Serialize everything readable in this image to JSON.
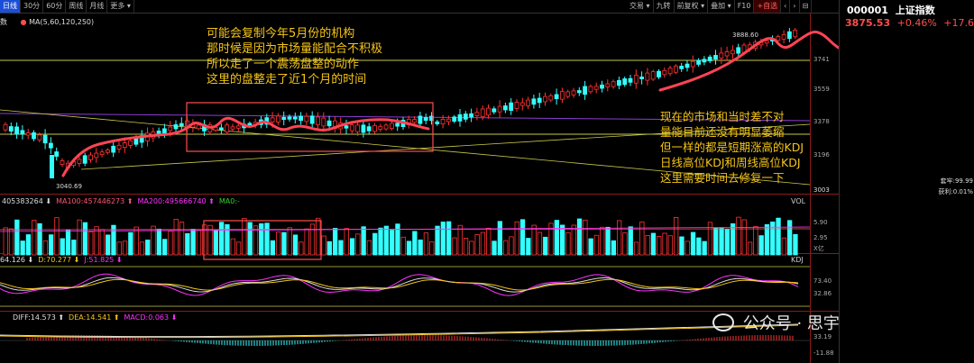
{
  "toolbar_left": [
    "日线",
    "30分",
    "60分",
    "周线",
    "月线",
    "更多 ▾"
  ],
  "toolbar_right": [
    "交易 ▾",
    "九转",
    "前复权 ▾",
    "叠加 ▾",
    "F10",
    "+自选",
    "‹",
    "›",
    "⊟"
  ],
  "ma_label": "MA(5,60,120,250)",
  "vol_title": "VOL",
  "vol_labels": [
    {
      "text": "405383264 ⬇",
      "color": "#dddddd"
    },
    {
      "text": "MA100:457446273 ⬆",
      "color": "#ff5577"
    },
    {
      "text": "MA200:495666740 ⬆",
      "color": "#ff33ff"
    },
    {
      "text": "MA0:-",
      "color": "#33cc33"
    }
  ],
  "kdj_title": "KDJ",
  "kdj_labels": [
    {
      "text": "64.126 ⬇",
      "color": "#dddddd"
    },
    {
      "text": "D:70.277 ⬇",
      "color": "#f5c518"
    },
    {
      "text": "J:51.825 ⬇",
      "color": "#ff33ff"
    }
  ],
  "macd_labels": [
    {
      "text": "DIFF:14.573 ⬆",
      "color": "#dddddd"
    },
    {
      "text": "DEA:14.541 ⬆",
      "color": "#f5c518"
    },
    {
      "text": "MACD:0.063 ⬇",
      "color": "#ff33ff"
    }
  ],
  "price_axis": [
    "3888.60",
    "3741",
    "3559",
    "3378",
    "3196",
    "3003"
  ],
  "low_label": "3040.69",
  "high_label": "3888.60",
  "vol_axis": [
    "5.90",
    "2.95",
    "X亿"
  ],
  "kdj_axis": [
    "73.40",
    "32.86"
  ],
  "macd_axis": [
    "33.19",
    "-11.88"
  ],
  "right_panel": {
    "code": "000001",
    "name": "上证指数",
    "price": "3875.53",
    "pct": "+0.46%",
    "chg": "+17.60",
    "stat1": "套牢:99.99",
    "stat2": "获利:0.01%",
    "price_color": "#ff4d4d"
  },
  "annotation_top": [
    "可能会复制今年5月份的机构",
    "那时候是因为市场量能配合不积极",
    "所以走了一个震荡盘整的动作",
    "这里的盘整走了近1个月的时间"
  ],
  "annotation_right": [
    "现在的市场和当时差不对",
    "量能目前还没有明显萎缩",
    "但一样的都是短期涨高的KDJ",
    "日线高位KDJ和周线高位KDJ",
    "这里需要时间去修复一下"
  ],
  "watermark": "公众号 · 思宇金融",
  "colors": {
    "up": "#ff3333",
    "down": "#33ffff",
    "annotation": "#f5c518",
    "trend": "#ff4455"
  }
}
